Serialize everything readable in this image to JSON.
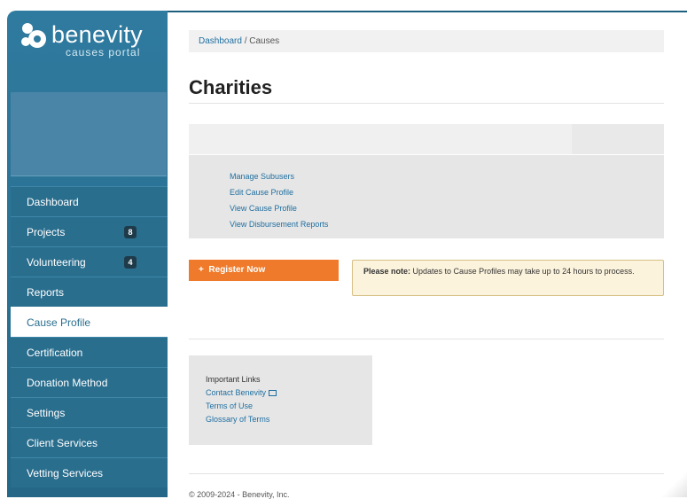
{
  "brand": {
    "name": "benevity",
    "subtitle": "causes portal",
    "color": "#2b7395"
  },
  "breadcrumb": {
    "home": "Dashboard",
    "separator": " / ",
    "current": "Causes"
  },
  "page": {
    "title": "Charities"
  },
  "sidebar": {
    "items": [
      {
        "label": "Dashboard"
      },
      {
        "label": "Projects",
        "badge": "8"
      },
      {
        "label": "Volunteering",
        "badge": "4"
      },
      {
        "label": "Reports"
      },
      {
        "label": "Cause Profile",
        "active": true
      },
      {
        "label": "Certification"
      },
      {
        "label": "Donation Method"
      },
      {
        "label": "Settings"
      },
      {
        "label": "Client Services"
      },
      {
        "label": "Vetting Services"
      }
    ]
  },
  "panel": {
    "links": [
      "Manage Subusers",
      "Edit Cause Profile",
      "View Cause Profile",
      "View Disbursement Reports"
    ]
  },
  "register": {
    "icon": "+",
    "label": "Register Now",
    "color": "#f07a2b"
  },
  "note": {
    "bold": "Please note:",
    "text": " Updates to Cause Profiles may take up to 24 hours to process."
  },
  "important_links": {
    "heading": "Important Links",
    "contact": "Contact Benevity",
    "terms": "Terms of Use",
    "glossary": "Glossary of Terms"
  },
  "footer": {
    "text": "© 2009-2024 - Benevity, Inc."
  }
}
